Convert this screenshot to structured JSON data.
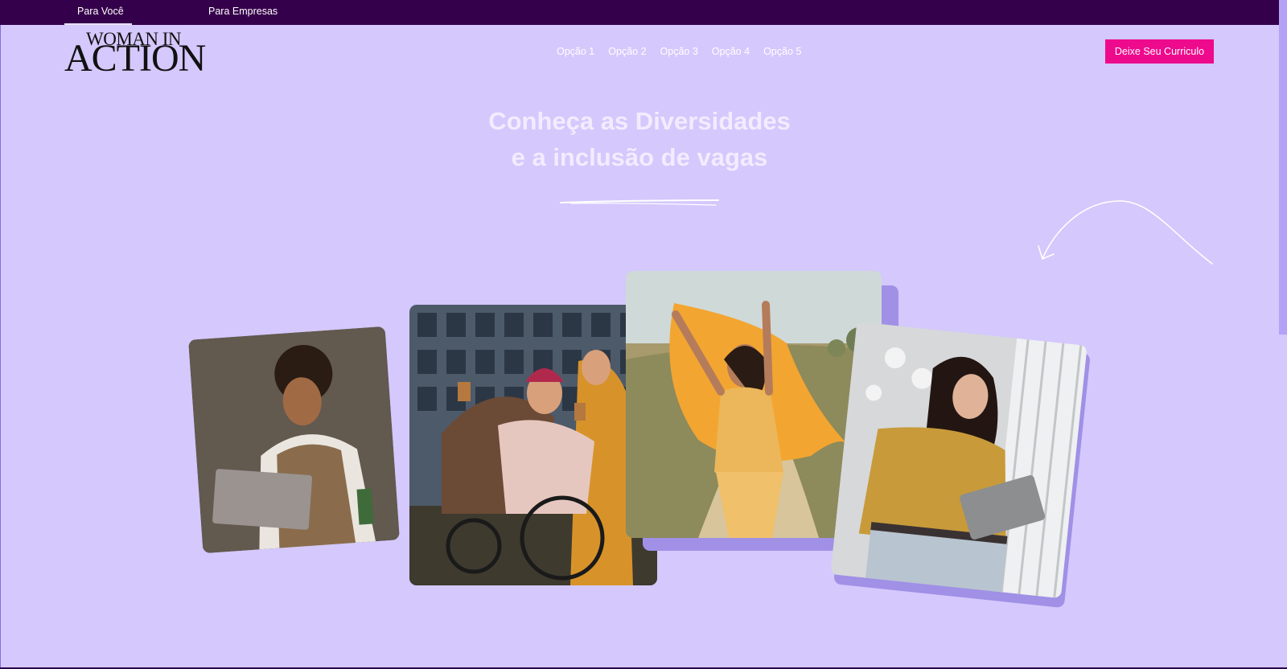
{
  "topbar": {
    "tabs": [
      {
        "label": "Para Você",
        "active": true
      },
      {
        "label": "Para Empresas",
        "active": false
      }
    ]
  },
  "logo": {
    "line1": "WOMAN IN",
    "line2": "ACTION"
  },
  "nav": {
    "items": [
      "Opção 1",
      "Opção 2",
      "Opção 3",
      "Opção 4",
      "Opção 5"
    ]
  },
  "cta": {
    "label": "Deixe Seu Curriculo"
  },
  "hero": {
    "line1": "Conheça as Diversidades",
    "line2": "e a inclusão de vagas"
  },
  "colors": {
    "background": "#d4c8fd",
    "topbar": "#35004b",
    "cta": "#ee0a8c",
    "hero_text": "#f2ecff"
  },
  "photos": [
    {
      "name": "woman-phone-laptop-photo"
    },
    {
      "name": "friends-wheelchair-photo"
    },
    {
      "name": "woman-orange-scarf-photo"
    },
    {
      "name": "woman-tablet-photo"
    }
  ]
}
